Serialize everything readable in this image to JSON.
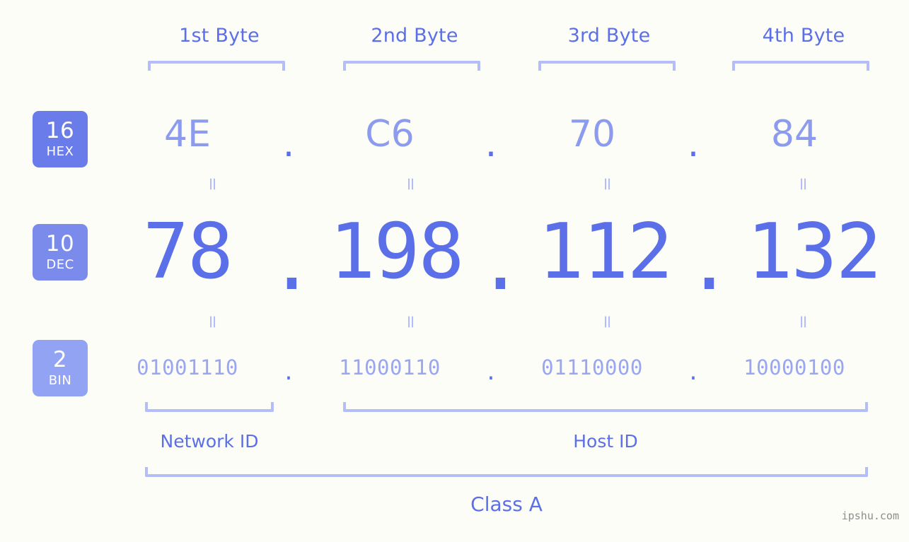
{
  "meta": {
    "background_color": "#fcfdf7",
    "accent_color": "#5b6fe8",
    "light_accent_color": "#b4bdf7",
    "watermark": "ipshu.com"
  },
  "byte_headers": [
    {
      "label": "1st Byte"
    },
    {
      "label": "2nd Byte"
    },
    {
      "label": "3rd Byte"
    },
    {
      "label": "4th Byte"
    }
  ],
  "bases": [
    {
      "number": "16",
      "name": "HEX",
      "color": "#6a7ce9"
    },
    {
      "number": "10",
      "name": "DEC",
      "color": "#7b8bec"
    },
    {
      "number": "2",
      "name": "BIN",
      "color": "#93a3f3"
    }
  ],
  "rows": {
    "hex": {
      "base_label": "HEX",
      "values": [
        "4E",
        "C6",
        "70",
        "84"
      ],
      "separator": "."
    },
    "dec": {
      "base_label": "DEC",
      "values": [
        "78",
        "198",
        "112",
        "132"
      ],
      "separator": "."
    },
    "bin": {
      "base_label": "BIN",
      "values": [
        "01001110",
        "11000110",
        "01110000",
        "10000100"
      ],
      "separator": "."
    }
  },
  "equals_markers": {
    "symbol": "=",
    "count_per_row": 4
  },
  "segments": {
    "network_id": {
      "label": "Network ID"
    },
    "host_id": {
      "label": "Host ID"
    },
    "class": {
      "label": "Class A"
    }
  }
}
